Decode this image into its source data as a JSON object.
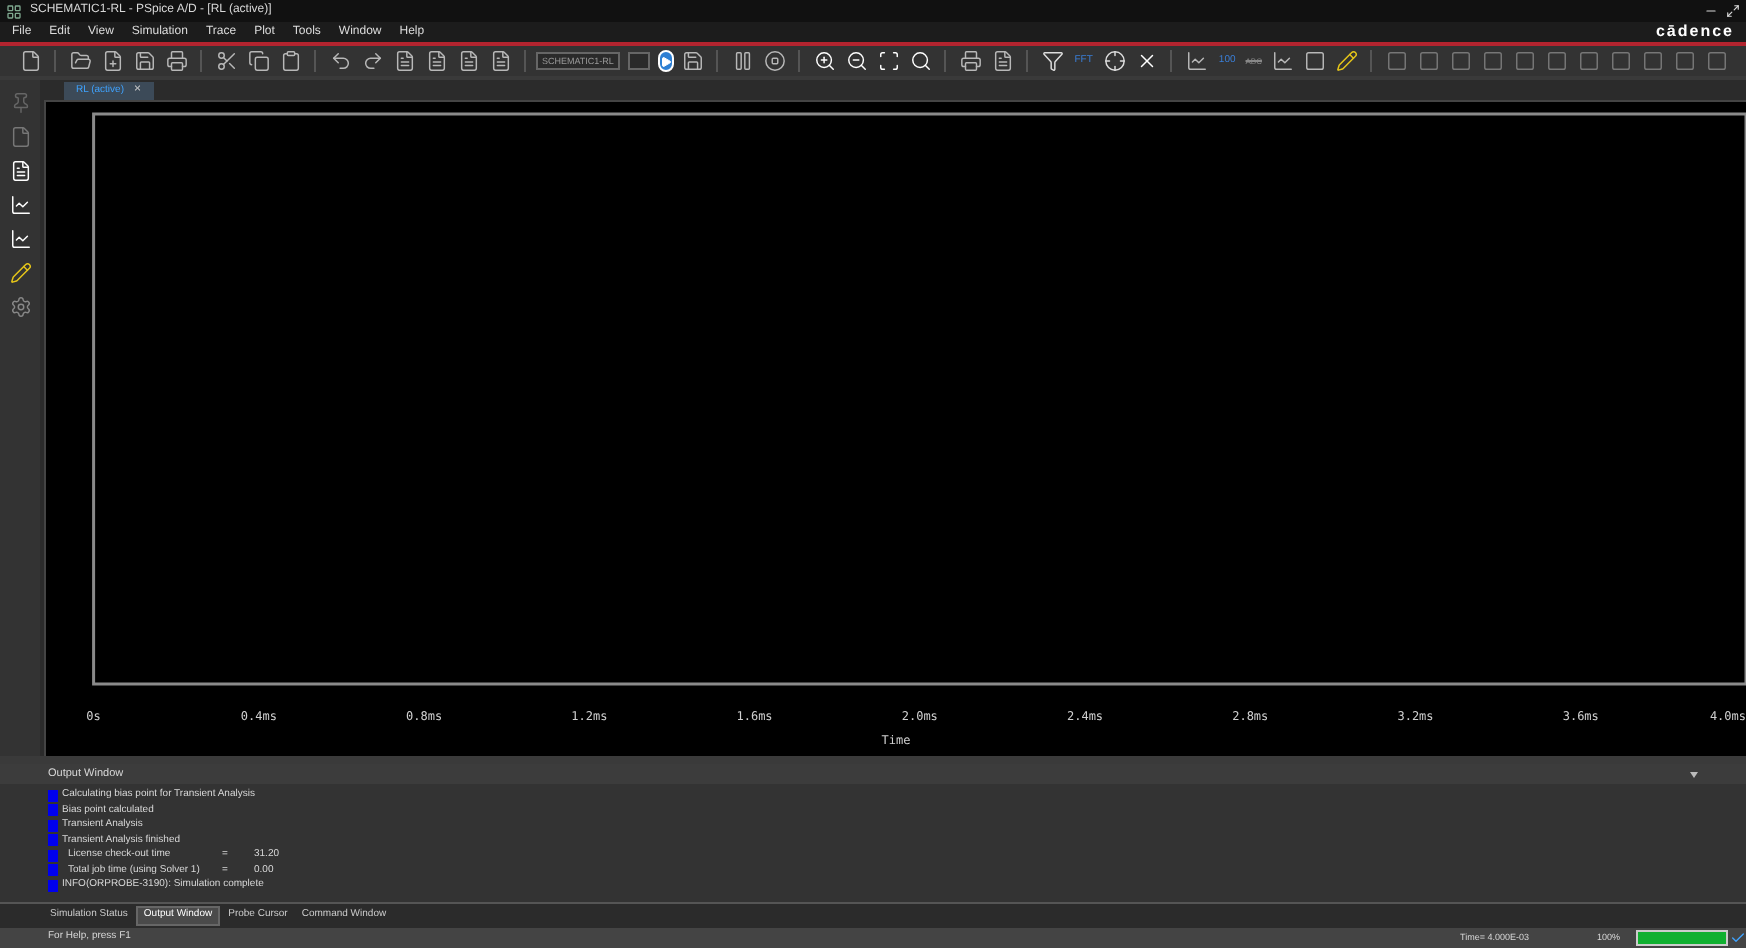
{
  "window": {
    "title": "SCHEMATIC1-RL - PSpice A/D - [RL (active)]",
    "brand": "cādence"
  },
  "menu": [
    "File",
    "Edit",
    "View",
    "Simulation",
    "Trace",
    "Plot",
    "Tools",
    "Window",
    "Help"
  ],
  "toolbar": {
    "profile_field": "SCHEMATIC1-RL",
    "fft_label": "FFT",
    "performance_label": "100",
    "abc_label": "ABC"
  },
  "document_tabs": [
    {
      "label": "RL (active)",
      "close": "×",
      "selected": true
    }
  ],
  "plot": {
    "x_axis": {
      "title": "Time",
      "tick_labels": [
        "0s",
        "0.4ms",
        "0.8ms",
        "1.2ms",
        "1.6ms",
        "2.0ms",
        "2.4ms",
        "2.8ms",
        "3.2ms",
        "3.6ms",
        "4.0ms"
      ]
    }
  },
  "output_window": {
    "title": "Output Window",
    "lines": [
      {
        "text": "Calculating bias point for Transient Analysis"
      },
      {
        "text": "Bias point calculated"
      },
      {
        "text": "Transient Analysis"
      },
      {
        "text": "Transient Analysis finished"
      },
      {
        "text": "License check-out time",
        "equals": "=",
        "value": "31.20"
      },
      {
        "text": "Total job time (using Solver 1)",
        "equals": "=",
        "value": "0.00"
      },
      {
        "text": "INFO(ORPROBE-3190): Simulation complete"
      }
    ]
  },
  "bottom_tabs": [
    {
      "label": "Simulation Status",
      "selected": false
    },
    {
      "label": "Output Window",
      "selected": true
    },
    {
      "label": "Probe Cursor",
      "selected": false
    },
    {
      "label": "Command Window",
      "selected": false
    }
  ],
  "status_bar": {
    "help": "For Help, press F1",
    "time": "Time= 4.000E-03",
    "percent": "100%",
    "progress": {
      "level": 1
    }
  }
}
